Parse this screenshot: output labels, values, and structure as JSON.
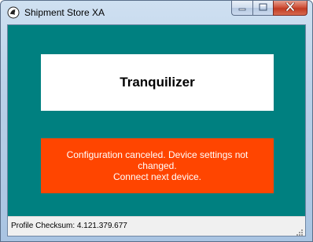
{
  "window": {
    "title": "Shipment Store XA",
    "app_icon": "app-icon",
    "caption_buttons": {
      "minimize_icon": "minimize-icon",
      "maximize_icon": "maximize-icon",
      "close_icon": "close-icon"
    }
  },
  "main": {
    "background_color": "#008080",
    "device_name": "Tranquilizer",
    "message": {
      "line1": "Configuration canceled. Device settings not",
      "line2": "changed.",
      "line3": "Connect next device.",
      "background_color": "#ff4500"
    }
  },
  "statusbar": {
    "text": "Profile Checksum: 4.121.379.677"
  }
}
